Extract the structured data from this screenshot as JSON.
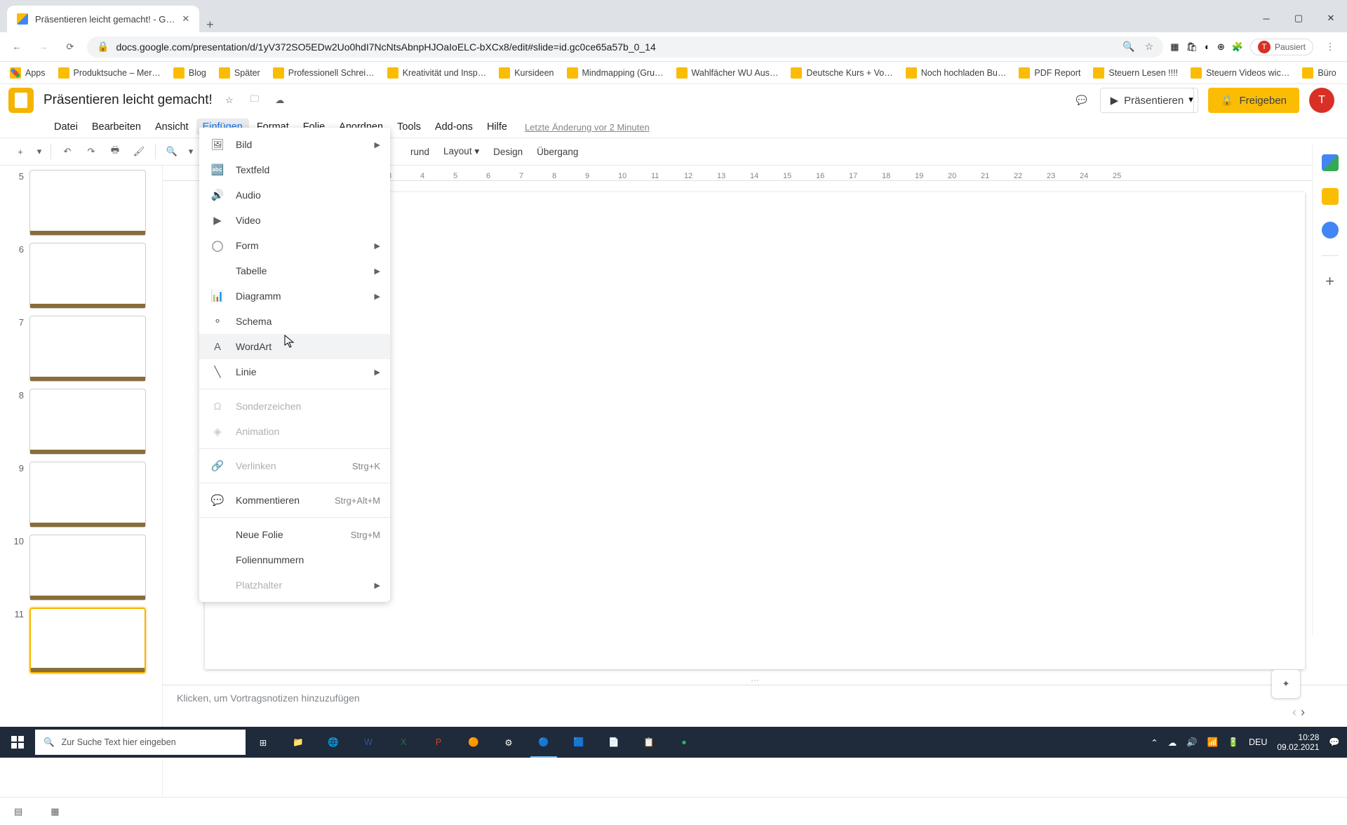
{
  "browser": {
    "tab_title": "Präsentieren leicht gemacht! - G…",
    "url": "docs.google.com/presentation/d/1yV372SO5EDw2Uo0hdI7NcNtsAbnpHJOaIoELC-bXCx8/edit#slide=id.gc0ce65a57b_0_14",
    "paused_label": "Pausiert"
  },
  "bookmarks": [
    {
      "label": "Apps",
      "fav": "apps"
    },
    {
      "label": "Produktsuche – Mer…"
    },
    {
      "label": "Blog"
    },
    {
      "label": "Später"
    },
    {
      "label": "Professionell Schrei…"
    },
    {
      "label": "Kreativität und Insp…"
    },
    {
      "label": "Kursideen"
    },
    {
      "label": "Mindmapping  (Gru…"
    },
    {
      "label": "Wahlfächer WU Aus…"
    },
    {
      "label": "Deutsche Kurs + Vo…"
    },
    {
      "label": "Noch hochladen Bu…"
    },
    {
      "label": "PDF Report"
    },
    {
      "label": "Steuern Lesen !!!!"
    },
    {
      "label": "Steuern Videos wic…"
    },
    {
      "label": "Büro"
    }
  ],
  "app": {
    "doc_title": "Präsentieren leicht gemacht!",
    "present_label": "Präsentieren",
    "share_label": "Freigeben",
    "last_edit": "Letzte Änderung vor 2 Minuten"
  },
  "menubar": [
    "Datei",
    "Bearbeiten",
    "Ansicht",
    "Einfügen",
    "Format",
    "Folie",
    "Anordnen",
    "Tools",
    "Add-ons",
    "Hilfe"
  ],
  "menubar_active": 3,
  "toolbar_right": [
    "rund",
    "Layout",
    "Design",
    "Übergang"
  ],
  "dropdown": [
    {
      "icon": "🖼",
      "label": "Bild",
      "sub": true
    },
    {
      "icon": "🔤",
      "label": "Textfeld"
    },
    {
      "icon": "🔊",
      "label": "Audio"
    },
    {
      "icon": "▶",
      "label": "Video"
    },
    {
      "icon": "◯",
      "label": "Form",
      "sub": true
    },
    {
      "icon": "",
      "label": "Tabelle",
      "sub": true
    },
    {
      "icon": "📊",
      "label": "Diagramm",
      "sub": true
    },
    {
      "icon": "⚬",
      "label": "Schema"
    },
    {
      "icon": "A",
      "label": "WordArt",
      "hover": true
    },
    {
      "icon": "╲",
      "label": "Linie",
      "sub": true
    },
    {
      "sep": true
    },
    {
      "icon": "Ω",
      "label": "Sonderzeichen",
      "disabled": true
    },
    {
      "icon": "◈",
      "label": "Animation",
      "disabled": true
    },
    {
      "sep": true
    },
    {
      "icon": "🔗",
      "label": "Verlinken",
      "short": "Strg+K",
      "disabled": true
    },
    {
      "sep": true
    },
    {
      "icon": "💬",
      "label": "Kommentieren",
      "short": "Strg+Alt+M"
    },
    {
      "sep": true
    },
    {
      "icon": "",
      "label": "Neue Folie",
      "short": "Strg+M"
    },
    {
      "icon": "",
      "label": "Foliennummern"
    },
    {
      "icon": "",
      "label": "Platzhalter",
      "sub": true,
      "disabled": true
    }
  ],
  "slides": [
    {
      "num": "5"
    },
    {
      "num": "6"
    },
    {
      "num": "7"
    },
    {
      "num": "8",
      "sel": false
    },
    {
      "num": "9"
    },
    {
      "num": "10"
    },
    {
      "num": "11",
      "sel": true
    }
  ],
  "ruler_marks": [
    "3",
    "4",
    "5",
    "6",
    "7",
    "8",
    "9",
    "10",
    "11",
    "12",
    "13",
    "14",
    "15",
    "16",
    "17",
    "18",
    "19",
    "20",
    "21",
    "22",
    "23",
    "24",
    "25"
  ],
  "notes_placeholder": "Klicken, um Vortragsnotizen hinzuzufügen",
  "taskbar": {
    "search_placeholder": "Zur Suche Text hier eingeben",
    "lang": "DEU",
    "time": "10:28",
    "date": "09.02.2021"
  }
}
